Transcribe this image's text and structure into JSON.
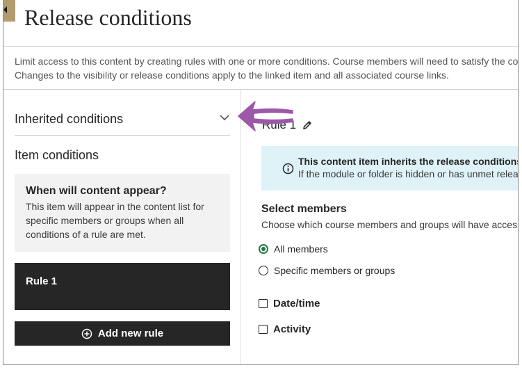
{
  "page": {
    "title": "Release conditions",
    "description_line1": "Limit access to this content by creating rules with one or more conditions. Course members will need to satisfy the cor",
    "description_line2": "Changes to the visibility or release conditions apply to the linked item and all associated course links."
  },
  "left": {
    "inherited_title": "Inherited conditions",
    "item_conditions_title": "Item conditions",
    "info_box": {
      "title": "When will content appear?",
      "text_line1": "This item will appear in the content list for",
      "text_line2": "specific members or groups when all",
      "text_line3": "conditions of a rule are met."
    },
    "rule_card_label": "Rule 1",
    "add_rule_label": "Add new rule"
  },
  "right": {
    "rule_heading": "Rule 1",
    "notice": {
      "title": "This content item inherits the release conditions o",
      "text": "If the module or folder is hidden or has unmet relea"
    },
    "select_members_title": "Select members",
    "select_members_desc": "Choose which course members and groups will have access",
    "members_options": [
      {
        "label": "All members",
        "checked": true
      },
      {
        "label": "Specific members or groups",
        "checked": false
      }
    ],
    "conditions": [
      {
        "label": "Date/time",
        "checked": false
      },
      {
        "label": "Activity",
        "checked": false
      }
    ]
  },
  "colors": {
    "accent_tab": "#b49b6e",
    "dark_button": "#262626",
    "notice_bg": "#def2f7",
    "radio_selected": "#1f7a3c",
    "annotation_arrow": "#9b59a8"
  },
  "icons": [
    "back-icon",
    "chevron-down-icon",
    "plus-circle-icon",
    "pencil-icon",
    "info-circle-icon",
    "arrow-annotation"
  ]
}
